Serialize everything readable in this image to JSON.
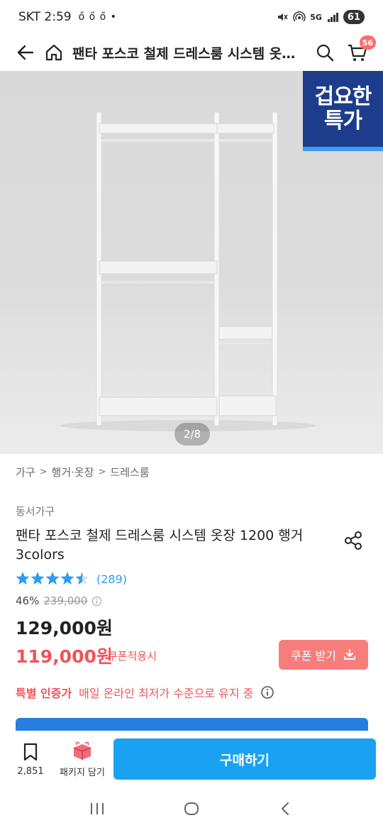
{
  "status_bar": {
    "carrier_time": "SKT 2:59",
    "notification_dots": "ő ő ő •",
    "network": "5G",
    "battery": "61"
  },
  "header": {
    "title": "팬타 포스코 철제 드레스룸 시스템 옷장 1200 행거 3colors",
    "cart_count": "56"
  },
  "hero": {
    "badge_line1": "겁요한",
    "badge_line2": "특가",
    "page_indicator": "2/8"
  },
  "breadcrumb": [
    "가구",
    "행거·옷장",
    "드레스룸"
  ],
  "product": {
    "brand": "동서가구",
    "title": "팬타 포스코 철제 드레스룸 시스템 옷장 1200 행거 3colors",
    "rating": 4.5,
    "rating_count": "(289)",
    "discount_rate": "46%",
    "original_price": "239,000",
    "price": "129,000원",
    "coupon_price": "119,000원",
    "coupon_applied_label": "쿠폰적용시",
    "coupon_button": "쿠폰 받기",
    "certified_label": "특별 인증가",
    "certified_desc": "매일 온라인 최저가 수준으로 유지 중"
  },
  "bottom_bar": {
    "bookmark_count": "2,851",
    "package_label": "패키지 담기",
    "buy_button": "구매하기"
  },
  "colors": {
    "accent_blue": "#1aa1f2",
    "price_red": "#f0545a",
    "coupon_button": "#f77d7d",
    "deal_badge": "#1d3d8c"
  }
}
